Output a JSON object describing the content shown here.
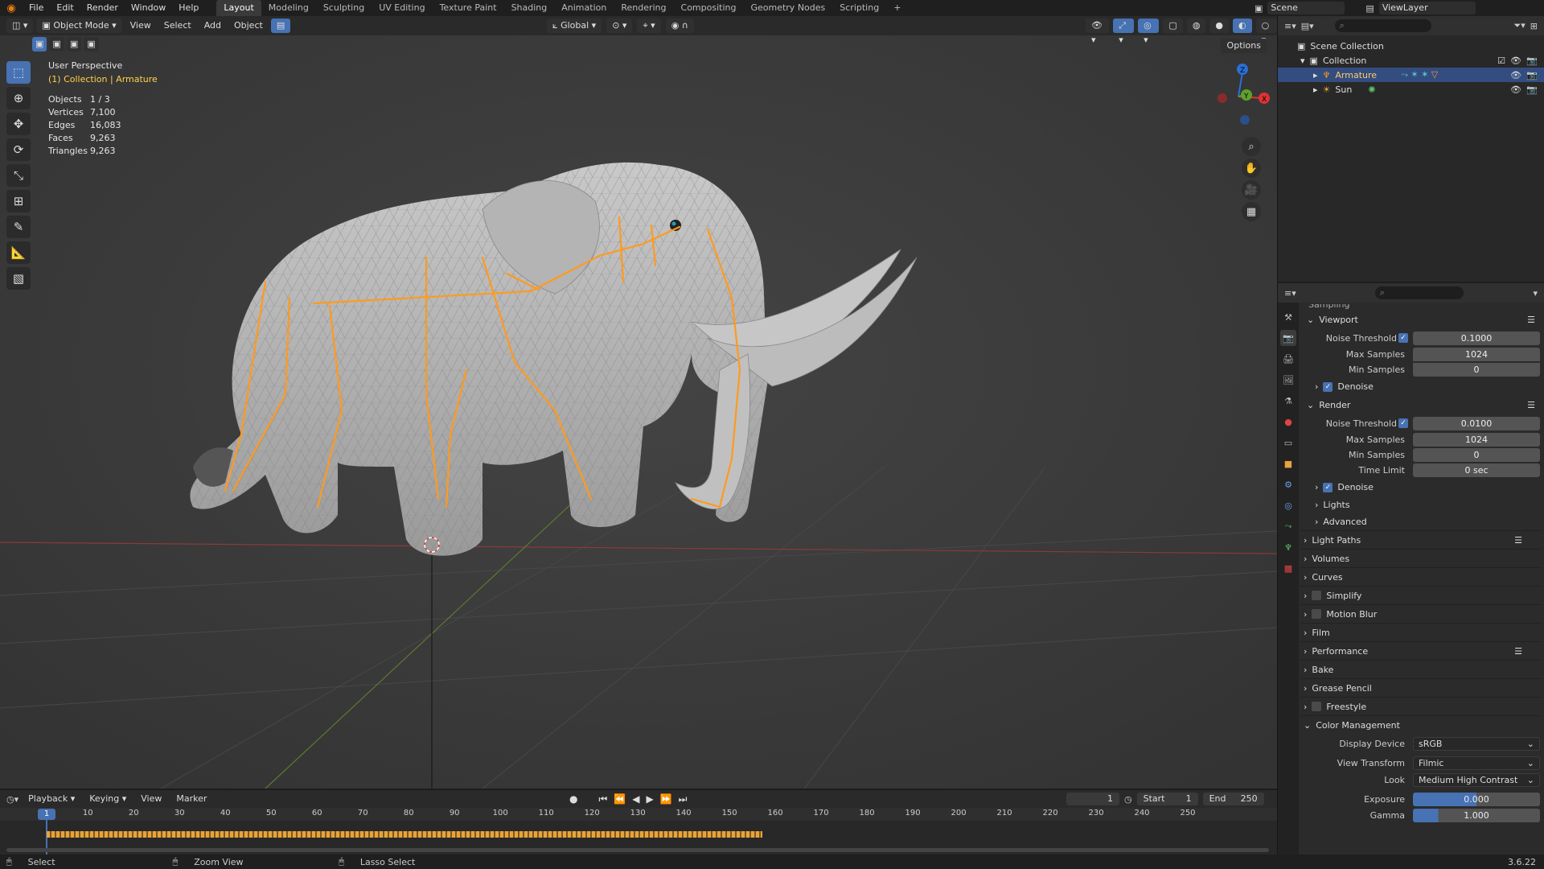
{
  "topbar": {
    "menus": [
      "File",
      "Edit",
      "Render",
      "Window",
      "Help"
    ],
    "workspaces": [
      "Layout",
      "Modeling",
      "Sculpting",
      "UV Editing",
      "Texture Paint",
      "Shading",
      "Animation",
      "Rendering",
      "Compositing",
      "Geometry Nodes",
      "Scripting"
    ],
    "active_workspace": "Layout",
    "scene": "Scene",
    "view_layer": "ViewLayer"
  },
  "viewport": {
    "mode": "Object Mode",
    "menus": [
      "View",
      "Select",
      "Add",
      "Object"
    ],
    "transform": "Global",
    "options": "Options",
    "perspective": "User Perspective",
    "context": "(1) Collection | Armature",
    "stats": [
      {
        "k": "Objects",
        "v": "1 / 3"
      },
      {
        "k": "Vertices",
        "v": "7,100"
      },
      {
        "k": "Edges",
        "v": "16,083"
      },
      {
        "k": "Faces",
        "v": "9,263"
      },
      {
        "k": "Triangles",
        "v": "9,263"
      }
    ],
    "axes": {
      "x": "X",
      "y": "Y",
      "z": "Z"
    }
  },
  "outliner": {
    "root": "Scene Collection",
    "collection": "Collection",
    "items": [
      "Armature",
      "Sun"
    ]
  },
  "properties": {
    "partial_header": "Sampling",
    "viewport": {
      "title": "Viewport",
      "noise_threshold_label": "Noise Threshold",
      "noise_threshold": "0.1000",
      "max_samples_label": "Max Samples",
      "max_samples": "1024",
      "min_samples_label": "Min Samples",
      "min_samples": "0",
      "denoise": "Denoise"
    },
    "render": {
      "title": "Render",
      "noise_threshold_label": "Noise Threshold",
      "noise_threshold": "0.0100",
      "max_samples_label": "Max Samples",
      "max_samples": "1024",
      "min_samples_label": "Min Samples",
      "min_samples": "0",
      "time_limit_label": "Time Limit",
      "time_limit": "0 sec",
      "denoise": "Denoise"
    },
    "subsections": [
      "Lights",
      "Advanced"
    ],
    "panels": [
      "Light Paths",
      "Volumes",
      "Curves",
      "Simplify",
      "Motion Blur",
      "Film",
      "Performance",
      "Bake",
      "Grease Pencil",
      "Freestyle"
    ],
    "color_management": {
      "title": "Color Management",
      "display_device_label": "Display Device",
      "display_device": "sRGB",
      "view_transform_label": "View Transform",
      "view_transform": "Filmic",
      "look_label": "Look",
      "look": "Medium High Contrast",
      "exposure_label": "Exposure",
      "exposure": "0.000",
      "gamma_label": "Gamma",
      "gamma": "1.000"
    }
  },
  "timeline": {
    "menus": [
      "Playback",
      "Keying",
      "View",
      "Marker"
    ],
    "current_frame": "1",
    "start_label": "Start",
    "start": "1",
    "end_label": "End",
    "end": "250",
    "ticks": [
      "1",
      "10",
      "20",
      "30",
      "40",
      "50",
      "60",
      "70",
      "80",
      "90",
      "100",
      "110",
      "120",
      "130",
      "140",
      "150",
      "160",
      "170",
      "180",
      "190",
      "200",
      "210",
      "220",
      "230",
      "240",
      "250"
    ]
  },
  "statusbar": {
    "items": [
      "Select",
      "Zoom View",
      "Lasso Select"
    ],
    "version": "3.6.22"
  }
}
